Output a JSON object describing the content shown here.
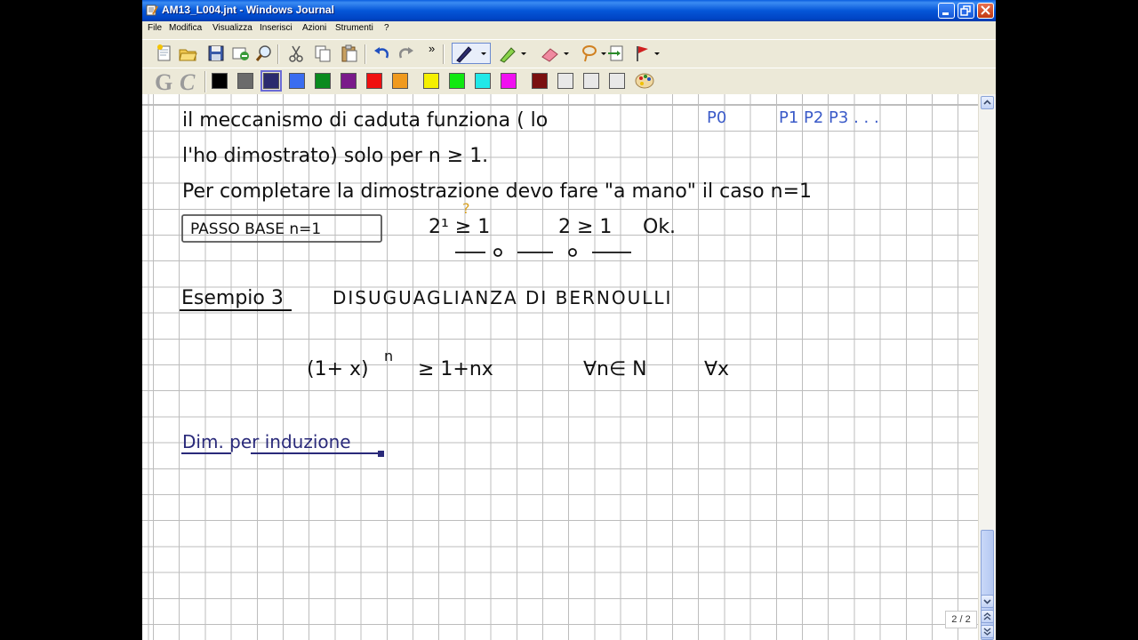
{
  "window": {
    "title": "AM13_L004.jnt - Windows Journal"
  },
  "menu": [
    "File",
    "Modifica",
    "Visualizza",
    "Inserisci",
    "Azioni",
    "Strumenti",
    "?"
  ],
  "toolbar": {
    "overflow_label": "»",
    "icons": [
      "new-note-icon",
      "open-icon",
      "save-icon",
      "send-mail-icon",
      "find-icon",
      "cut-icon",
      "copy-icon",
      "paste-icon",
      "undo-icon",
      "redo-icon",
      "pen-icon",
      "highlighter-icon",
      "eraser-icon",
      "lasso-select-icon",
      "insert-space-icon",
      "flag-icon"
    ],
    "format_letters": [
      "G",
      "C"
    ],
    "colors": [
      "#000000",
      "#6b6b6b",
      "#2b2b6e",
      "#3a6df0",
      "#0a8a1e",
      "#7a1a8a",
      "#f01010",
      "#f09a1e",
      "#f5f000",
      "#10e810",
      "#20e8e8",
      "#f010f0",
      "#7a1010",
      "#e8e8e8",
      "#e8e8e8",
      "#e8e8e8"
    ],
    "selected_color": "#2b2b6e",
    "palette_icon": "color-palette-icon"
  },
  "note": {
    "line1": "il meccanismo di caduta funziona ( lo",
    "annot_p0": "P0",
    "annot_seq": "P1 P2 P3 . . .",
    "line2": "l'ho dimostrato) solo per n ≥ 1.",
    "line3": "Per completare la dimostrazione devo fare \"a mano\" il caso n=1",
    "passo_base": "PASSO BASE  n=1",
    "check1": "2¹ ≥ 1",
    "check_q": "?",
    "check2": "2 ≥ 1",
    "ok": "Ok.",
    "esempio": "Esempio 3",
    "title": "DISUGUAGLIANZA  DI  BERNOULLI",
    "formula_lhs": "(1+ x)",
    "formula_exp": "n",
    "formula_rhs": "≥ 1+nx",
    "forall_n": "∀n∈ N",
    "forall_x": "∀x",
    "dim": "Dim. per induzione"
  },
  "page_indicator": "2 / 2"
}
